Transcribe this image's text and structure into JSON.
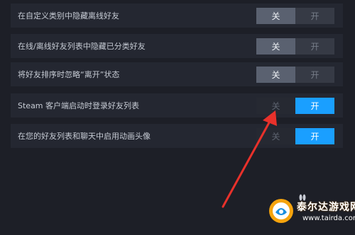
{
  "settings": [
    {
      "label": "在自定义类别中隐藏离线好友",
      "state": "off"
    },
    {
      "label": "在线/离线好友列表中隐藏已分类好友",
      "state": "off"
    },
    {
      "label": "将好友排序时忽略“离开”状态",
      "state": "off"
    },
    {
      "label": "Steam 客户端启动时登录好友列表",
      "state": "on"
    },
    {
      "label": "在您的好友列表和聊天中启用动画头像",
      "state": "on"
    }
  ],
  "toggle": {
    "off_label": "关",
    "on_label": "开"
  },
  "colors": {
    "background": "#1d1f27",
    "row": "#242731",
    "accent": "#1a9fff",
    "arrow": "#e8312b"
  },
  "watermark": {
    "title": "泰尔达游戏网",
    "url": "www.tairda.com"
  }
}
